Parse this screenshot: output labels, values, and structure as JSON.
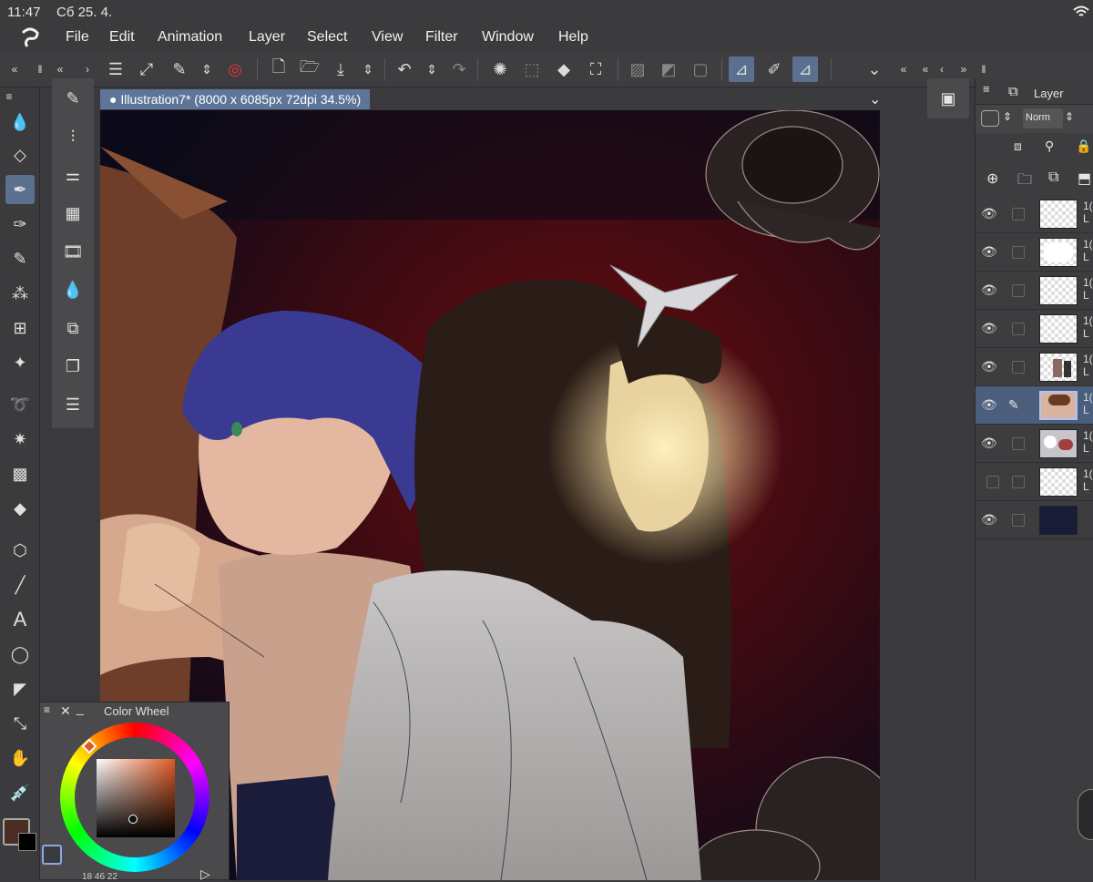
{
  "status": {
    "time": "11:47",
    "date": "Сб 25. 4."
  },
  "menu": [
    "File",
    "Edit",
    "Animation",
    "Layer",
    "Select",
    "View",
    "Filter",
    "Window",
    "Help"
  ],
  "canvas": {
    "title": "Illustration7* (8000 x 6085px 72dpi 34.5%)"
  },
  "layer_panel": {
    "title": "Layer",
    "blend_mode": "Norm"
  },
  "layers": [
    {
      "visible": true,
      "thumb": "transparent",
      "name": "1(",
      "sub": "L"
    },
    {
      "visible": true,
      "thumb": "white-blob",
      "name": "1(",
      "sub": "L"
    },
    {
      "visible": true,
      "thumb": "transparent",
      "name": "1(",
      "sub": "L"
    },
    {
      "visible": true,
      "thumb": "transparent",
      "name": "1(",
      "sub": "L"
    },
    {
      "visible": true,
      "thumb": "figures",
      "name": "1(",
      "sub": "L"
    },
    {
      "visible": true,
      "thumb": "face",
      "name": "1(",
      "sub": "L",
      "selected": true
    },
    {
      "visible": true,
      "thumb": "smudge",
      "name": "1(",
      "sub": "L"
    },
    {
      "visible": false,
      "thumb": "transparent",
      "name": "1(",
      "sub": "L"
    },
    {
      "visible": true,
      "thumb": "navy",
      "name": "",
      "sub": ""
    }
  ],
  "color_wheel": {
    "title": "Color Wheel",
    "current_color": "#4a2e24",
    "readout": "18  46  22"
  },
  "colors": {
    "accent": "#5b6f8e",
    "panel": "#3b3b3d",
    "tab": "#5d7599"
  }
}
